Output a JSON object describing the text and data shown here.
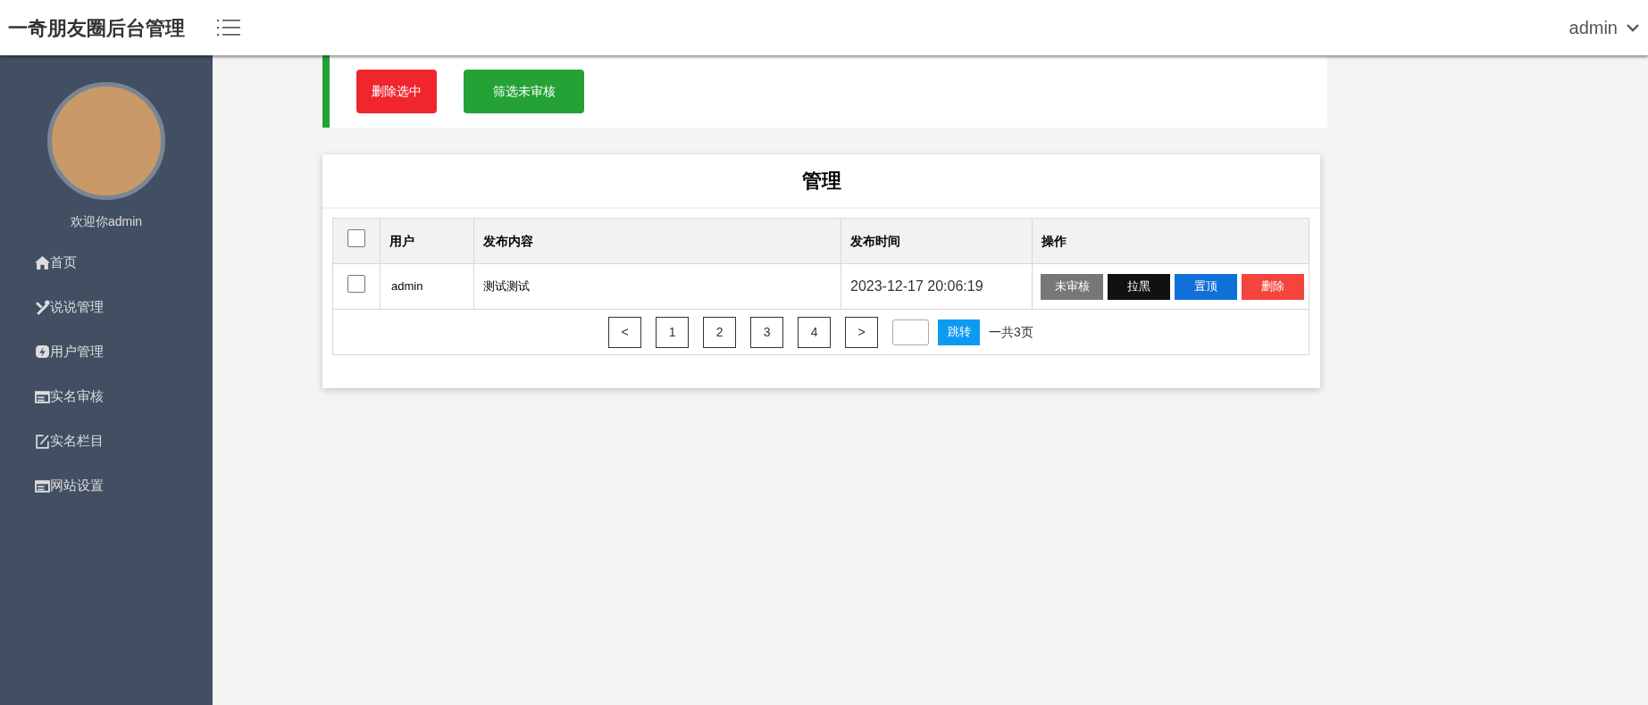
{
  "header": {
    "title": "一奇朋友圈后台管理",
    "user": "admin"
  },
  "sidebar": {
    "welcome": "欢迎你admin",
    "items": [
      {
        "label": "首页",
        "kind": "home"
      },
      {
        "label": "说说管理",
        "kind": "tools"
      },
      {
        "label": "用户管理",
        "kind": "bolt"
      },
      {
        "label": "实名审核",
        "kind": "card"
      },
      {
        "label": "实名栏目",
        "kind": "edit"
      },
      {
        "label": "网站设置",
        "kind": "card"
      }
    ]
  },
  "toolbar": {
    "buttons": [
      {
        "label": "删除选中",
        "kind": "danger"
      },
      {
        "label": "筛选未审核",
        "kind": "success"
      }
    ]
  },
  "card": {
    "title": "管理",
    "table": {
      "select_all_checked": false,
      "columns": [
        "用户",
        "发布内容",
        "发布时间",
        "操作"
      ],
      "rows": [
        {
          "checked": false,
          "user": "admin",
          "content": "测试测试",
          "time": "2023-12-17 20:06:19",
          "actions": [
            {
              "label": "未审核",
              "kind": "gray"
            },
            {
              "label": "拉黑",
              "kind": "black"
            },
            {
              "label": "置顶",
              "kind": "blue"
            },
            {
              "label": "删除",
              "kind": "red"
            }
          ]
        }
      ]
    },
    "pagination": {
      "prev": "<",
      "pages": [
        "1",
        "2",
        "3",
        "4"
      ],
      "next": ">",
      "jump": "跳转",
      "total": "一共3页"
    }
  }
}
